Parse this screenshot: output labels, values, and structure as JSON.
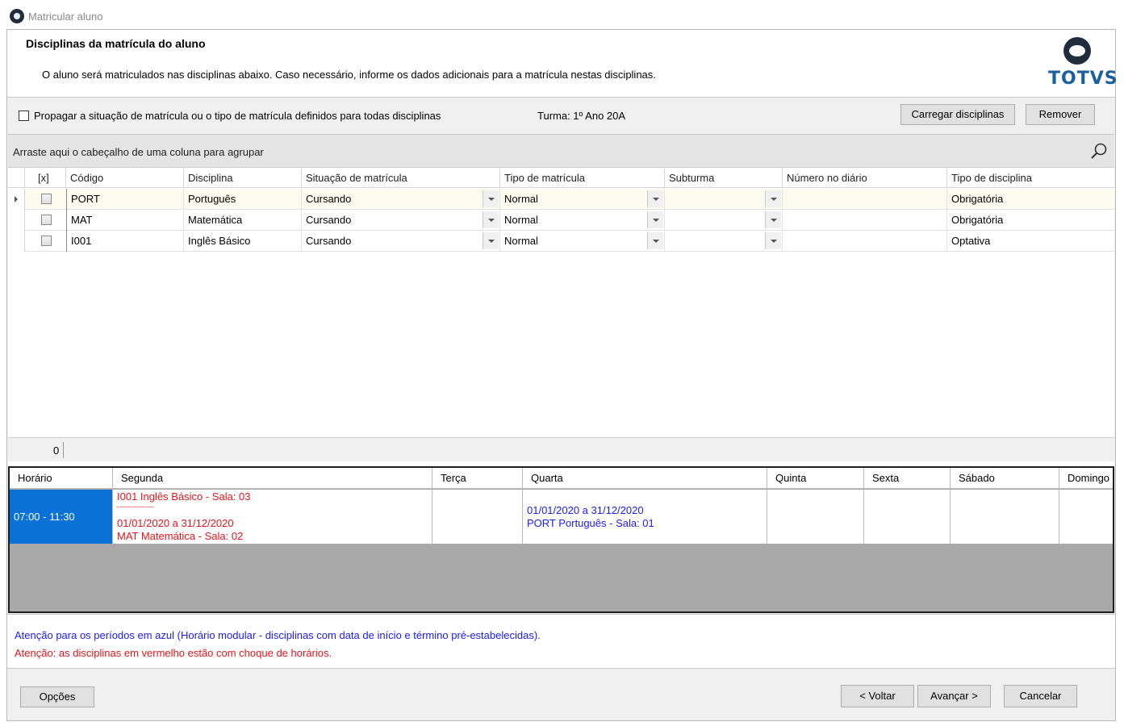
{
  "window": {
    "title": "Matricular aluno"
  },
  "header": {
    "title": "Disciplinas da matrícula do aluno",
    "description": "O aluno será matriculados nas disciplinas abaixo. Caso necessário, informe os dados adicionais para a matrícula nestas disciplinas.",
    "logo_text": "TOTVS"
  },
  "options": {
    "propagate_label": "Propagar a situação de matrícula ou o tipo de matrícula definidos para todas disciplinas",
    "propagate_checked": false,
    "turma": "Turma: 1º Ano 20A",
    "load_button": "Carregar disciplinas",
    "remove_button": "Remover"
  },
  "grid": {
    "group_hint": "Arraste aqui o cabeçalho de uma coluna para agrupar",
    "columns": {
      "check": "[x]",
      "codigo": "Código",
      "disciplina": "Disciplina",
      "situacao": "Situação de matrícula",
      "tipo": "Tipo de matrícula",
      "subturma": "Subturma",
      "numero": "Número no diário",
      "tipo_disciplina": "Tipo de disciplina"
    },
    "rows": [
      {
        "codigo": "PORT",
        "disciplina": "Português",
        "situacao": "Cursando",
        "tipo": "Normal",
        "subturma": "",
        "numero": "",
        "tipo_disciplina": "Obrigatória"
      },
      {
        "codigo": "MAT",
        "disciplina": "Matemática",
        "situacao": "Cursando",
        "tipo": "Normal",
        "subturma": "",
        "numero": "",
        "tipo_disciplina": "Obrigatória"
      },
      {
        "codigo": "I001",
        "disciplina": "Inglês Básico",
        "situacao": "Cursando",
        "tipo": "Normal",
        "subturma": "",
        "numero": "",
        "tipo_disciplina": "Optativa"
      }
    ],
    "footer_count": "0"
  },
  "schedule": {
    "headers": {
      "horario": "Horário",
      "segunda": "Segunda",
      "terca": "Terça",
      "quarta": "Quarta",
      "quinta": "Quinta",
      "sexta": "Sexta",
      "sabado": "Sábado",
      "domingo": "Domingo"
    },
    "row": {
      "time": "07:00 - 11:30",
      "segunda": {
        "line1": "I001  Inglês Básico - Sala: 03",
        "line2": "---------------",
        "line3": "01/01/2020 a 31/12/2020",
        "line4": "MAT  Matemática - Sala: 02"
      },
      "quarta": {
        "line1": "01/01/2020 a 31/12/2020",
        "line2": "PORT  Português - Sala: 01"
      }
    },
    "colors": {
      "time_bg": "#0a71d6",
      "conflict": "#e8141a",
      "modular": "#1a1aff"
    }
  },
  "notes": {
    "blue": "Atenção para os períodos em azul (Horário modular - disciplinas com data de início e término pré-estabelecidas).",
    "red": "Atenção: as disciplinas em vermelho estão com choque de horários."
  },
  "footer": {
    "options_button": "Opções",
    "back_button": "< Voltar",
    "next_button": "Avançar >",
    "cancel_button": "Cancelar"
  }
}
